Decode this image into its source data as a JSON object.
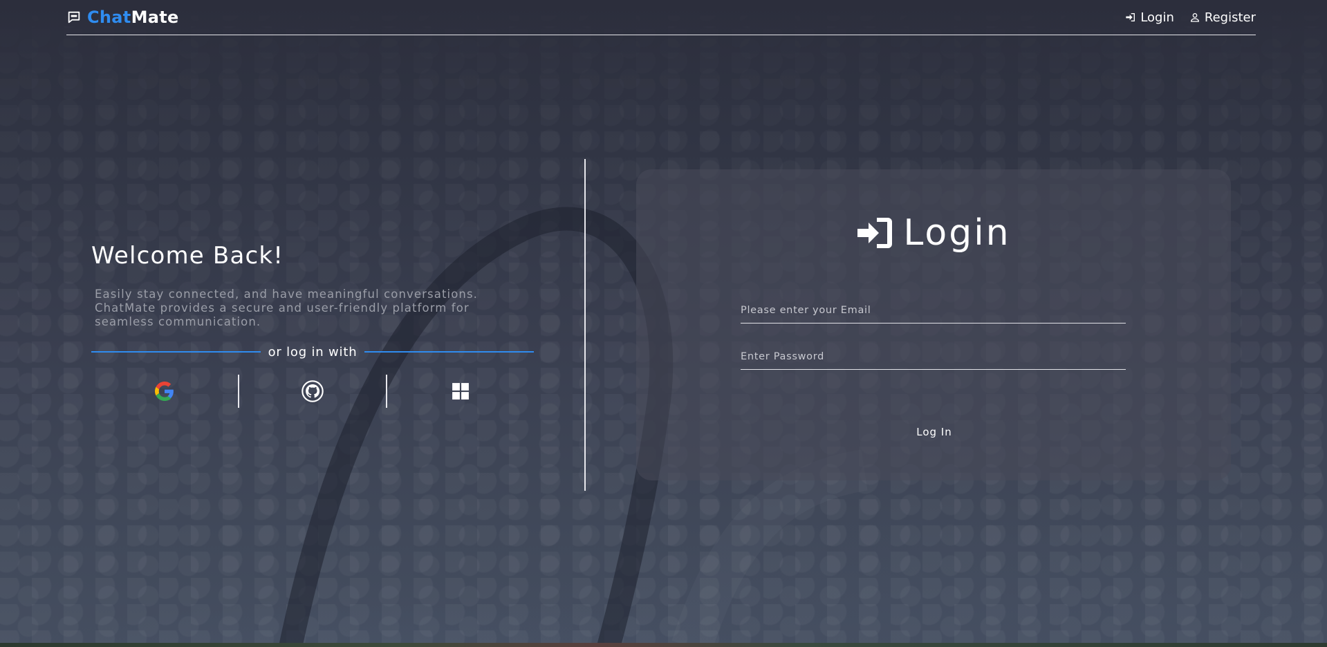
{
  "brand": {
    "part1": "Chat",
    "part2": "Mate",
    "icon": "chat-bubble-icon",
    "accent": "#2f8cf0"
  },
  "nav": {
    "login_label": "Login",
    "login_icon": "sign-in-icon",
    "register_label": "Register",
    "register_icon": "user-icon"
  },
  "welcome": {
    "title": "Welcome Back!",
    "tagline": "Easily stay connected, and have meaningful conversations. ChatMate provides a secure and user-friendly platform for seamless communication.",
    "divider_text": "or log in with",
    "providers": [
      {
        "name": "Google",
        "icon": "google-icon"
      },
      {
        "name": "GitHub",
        "icon": "github-icon"
      },
      {
        "name": "Microsoft",
        "icon": "microsoft-icon"
      }
    ]
  },
  "login_form": {
    "title": "Login",
    "title_icon": "sign-in-icon",
    "email_placeholder": "Please enter your Email",
    "email_value": "",
    "password_placeholder": "Enter Password",
    "password_value": "",
    "submit_label": "Log In"
  },
  "colors": {
    "background": "#2d2f3d",
    "text": "#ffffff",
    "muted_text": "#9b9ea8",
    "divider_accent": "#2f8cf0"
  }
}
